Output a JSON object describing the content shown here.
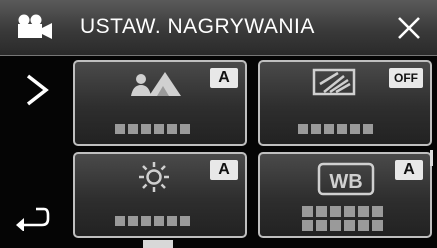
{
  "header": {
    "title": "USTAW. NAGRYWANIA",
    "mode_icon": "video-camera-icon",
    "close_icon": "close-icon"
  },
  "nav": {
    "next_icon": "chevron-right-icon",
    "back_icon": "return-arrow-icon"
  },
  "tiles": [
    {
      "icon": "scene-mountains-icon",
      "badge": "A"
    },
    {
      "icon": "backlight-compensation-icon",
      "badge": "OFF"
    },
    {
      "icon": "brightness-sun-icon",
      "badge": "A"
    },
    {
      "icon": "white-balance-icon",
      "icon_text": "WB",
      "badge": "A"
    }
  ],
  "colors": {
    "header_top": "#5a5a5a",
    "tile_border": "#bfbfbf",
    "badge_bg": "#e8e8e8"
  }
}
